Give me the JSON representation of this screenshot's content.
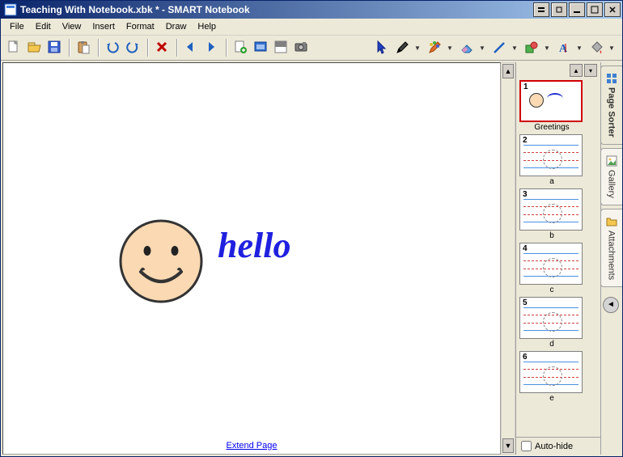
{
  "title": "Teaching With Notebook.xbk * - SMART Notebook",
  "menubar": [
    "File",
    "Edit",
    "View",
    "Insert",
    "Format",
    "Draw",
    "Help"
  ],
  "canvas": {
    "hello_text": "hello",
    "extend_label": "Extend Page"
  },
  "page_sorter": {
    "thumbnails": [
      {
        "num": "1",
        "label": "Greetings",
        "selected": true,
        "kind": "greetings"
      },
      {
        "num": "2",
        "label": "a",
        "selected": false,
        "kind": "ruled"
      },
      {
        "num": "3",
        "label": "b",
        "selected": false,
        "kind": "ruled"
      },
      {
        "num": "4",
        "label": "c",
        "selected": false,
        "kind": "ruled"
      },
      {
        "num": "5",
        "label": "d",
        "selected": false,
        "kind": "ruled"
      },
      {
        "num": "6",
        "label": "e",
        "selected": false,
        "kind": "ruled"
      }
    ],
    "autohide_label": "Auto-hide",
    "autohide_checked": false
  },
  "side_tabs": [
    {
      "label": "Page Sorter",
      "active": true,
      "icon": "grid-icon"
    },
    {
      "label": "Gallery",
      "active": false,
      "icon": "picture-icon"
    },
    {
      "label": "Attachments",
      "active": false,
      "icon": "folder-icon"
    }
  ],
  "toolbar": {
    "left": [
      {
        "name": "new-file-button",
        "icon": "new-icon"
      },
      {
        "name": "open-file-button",
        "icon": "open-icon"
      },
      {
        "name": "save-file-button",
        "icon": "save-icon"
      },
      {
        "name": "sep"
      },
      {
        "name": "paste-button",
        "icon": "paste-icon"
      },
      {
        "name": "sep"
      },
      {
        "name": "undo-button",
        "icon": "undo-icon"
      },
      {
        "name": "redo-button",
        "icon": "redo-icon"
      },
      {
        "name": "sep"
      },
      {
        "name": "delete-button",
        "icon": "delete-icon"
      },
      {
        "name": "sep"
      },
      {
        "name": "prev-page-button",
        "icon": "prev-icon"
      },
      {
        "name": "next-page-button",
        "icon": "next-icon"
      },
      {
        "name": "sep"
      },
      {
        "name": "add-page-button",
        "icon": "add-page-icon"
      },
      {
        "name": "fullscreen-button",
        "icon": "fullscreen-icon"
      },
      {
        "name": "screenshade-button",
        "icon": "shade-icon"
      },
      {
        "name": "capture-button",
        "icon": "camera-icon"
      }
    ],
    "right": [
      {
        "name": "select-tool-button",
        "icon": "pointer-icon",
        "drop": false
      },
      {
        "name": "pen-tool-button",
        "icon": "pen-icon",
        "drop": true
      },
      {
        "name": "creative-pen-button",
        "icon": "rainbow-pen-icon",
        "drop": true
      },
      {
        "name": "eraser-tool-button",
        "icon": "eraser-icon",
        "drop": true
      },
      {
        "name": "line-tool-button",
        "icon": "line-icon",
        "drop": true
      },
      {
        "name": "shape-tool-button",
        "icon": "shape-icon",
        "drop": true
      },
      {
        "name": "text-tool-button",
        "icon": "text-icon",
        "drop": true
      },
      {
        "name": "color-tool-button",
        "icon": "bucket-icon",
        "drop": true
      }
    ]
  }
}
